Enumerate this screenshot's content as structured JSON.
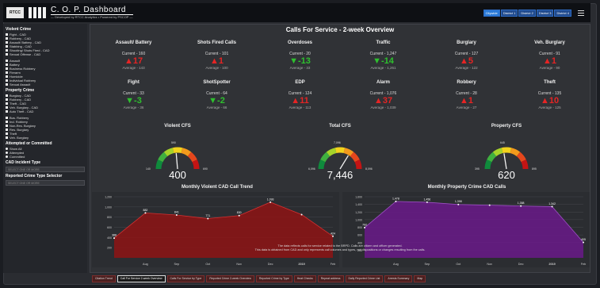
{
  "header": {
    "logo_text": "RTCC",
    "title": "C. O. P. Dashboard",
    "subtitle": "— Developed by RTCC Analytics • Powered by PSCOP —",
    "districts": [
      "Citywide",
      "District 1",
      "District 2",
      "District 3",
      "District 4"
    ],
    "active_district": "Citywide"
  },
  "sidebar": {
    "violent_title": "Violent Crime",
    "violent_items": [
      "Fight - CAD",
      "Robbery - CAD",
      "Assault/ Battery - CAD",
      "Stabbing - CAD",
      "Shooting/ Shots Fired - CAD",
      "Sexual Offense - CAD"
    ],
    "violent_items2": [
      "Assault",
      "Battery",
      "Business Robbery",
      "Firearm",
      "Homicide",
      "Individual Robbery",
      "Sexual Assault"
    ],
    "property_title": "Property Crime",
    "property_items": [
      "Burglary - CAD",
      "Robbery - CAD",
      "Theft - CAD",
      "Veh. Burglary - CAD",
      "Auto Theft - CAD"
    ],
    "property_items2": [
      "Bus. Robbery",
      "Ind. Robbery",
      "Non-Res. Burglary",
      "Res. Burglary",
      "Theft",
      "Veh. Burglary"
    ],
    "attempt_title": "Attempted or Committed",
    "attempt_options": [
      "Show All",
      "Attempted",
      "Committed"
    ],
    "cad_title": "CAD Incident Type",
    "cad_placeholder": "SELECT ONE OR MORE",
    "reported_title": "Reported Crime Type Selector",
    "reported_placeholder": "SELECT ONE OR MORE"
  },
  "main": {
    "title": "Calls For Service - 2-week Overview",
    "kpis": [
      {
        "name": "Assault/ Battery",
        "current": "Current - 160",
        "delta": "▲17",
        "dir": "up",
        "avg": "Average - 143"
      },
      {
        "name": "Shots Fired Calls",
        "current": "Current - 101",
        "delta": "▲1",
        "dir": "up",
        "avg": "Average - 100"
      },
      {
        "name": "Overdoses",
        "current": "Current - 20",
        "delta": "▼-13",
        "dir": "down",
        "avg": "Average - 33"
      },
      {
        "name": "Traffic",
        "current": "Current - 1,247",
        "delta": "▼-14",
        "dir": "down",
        "avg": "Average - 1,261"
      },
      {
        "name": "Burglary",
        "current": "Current - 127",
        "delta": "▲5",
        "dir": "up",
        "avg": "Average - 122"
      },
      {
        "name": "Veh. Burglary",
        "current": "Current - 91",
        "delta": "▲1",
        "dir": "up",
        "avg": "Average - 90"
      },
      {
        "name": "Fight",
        "current": "Current - 33",
        "delta": "▼-3",
        "dir": "down",
        "avg": "Average - 36"
      },
      {
        "name": "ShotSpotter",
        "current": "Current - 64",
        "delta": "▼-2",
        "dir": "down",
        "avg": "Average - 66"
      },
      {
        "name": "EDP",
        "current": "Current - 124",
        "delta": "▲11",
        "dir": "up",
        "avg": "Average - 113"
      },
      {
        "name": "Alarm",
        "current": "Current - 1,076",
        "delta": "▲37",
        "dir": "up",
        "avg": "Average - 1,039"
      },
      {
        "name": "Robbery",
        "current": "Current - 28",
        "delta": "▲1",
        "dir": "up",
        "avg": "Average - 27"
      },
      {
        "name": "Theft",
        "current": "Current - 135",
        "delta": "▲10",
        "dir": "up",
        "avg": "Average - 125"
      }
    ],
    "gauges": [
      {
        "title": "Violent CFS",
        "value": "400",
        "target": "590",
        "min": "140",
        "max": "690"
      },
      {
        "title": "Total CFS",
        "value": "7,446",
        "target": "7,096",
        "min": "6,096",
        "max": "8,096"
      },
      {
        "title": "Property CFS",
        "value": "620",
        "target": "645",
        "min": "395",
        "max": "895"
      }
    ],
    "footnote_1": "The data reflects calls for service related to the BRPD. Calls are citizen and officer generated.",
    "footnote_2": "This data is obtained from CAD and only represents call volumes and types, not dispositions or changes resulting from the calls."
  },
  "colors": {
    "up": "#e52424",
    "down": "#2ec02e",
    "violent_fill": "#8e1414",
    "property_fill": "#6a1a8a"
  },
  "chart_data": [
    {
      "type": "area",
      "title": "Monthly Violent CAD Call Trend",
      "x": [
        "Aug",
        "Sep",
        "Oct",
        "Nov",
        "Dec",
        "2019",
        "Feb"
      ],
      "x_points": [
        "Jul",
        "Aug",
        "Sep",
        "Oct",
        "Nov",
        "Dec",
        "Jan",
        "Feb"
      ],
      "values": [
        388,
        882,
        841,
        771,
        830,
        1093,
        850,
        424
      ],
      "data_labels": [
        "388",
        "882",
        "841",
        "771",
        "830",
        "1,093",
        "",
        "424"
      ],
      "yticks": [
        200,
        400,
        600,
        800,
        1000,
        1200
      ],
      "ylim": [
        0,
        1200
      ]
    },
    {
      "type": "area",
      "title": "Monthly Property Crime CAD Calls",
      "x": [
        "Aug",
        "Sep",
        "Oct",
        "Nov",
        "Dec",
        "2019",
        "Feb"
      ],
      "x_points": [
        "Jul",
        "Aug",
        "Sep",
        "Oct",
        "Nov",
        "Dec",
        "Jan",
        "Feb"
      ],
      "values": [
        792,
        1478,
        1456,
        1398,
        1380,
        1358,
        1342,
        405
      ],
      "data_labels": [
        "792",
        "1,478",
        "1,456",
        "1,398",
        "",
        "1,358",
        "1,342",
        "405"
      ],
      "yticks": [
        200,
        400,
        600,
        800,
        1000,
        1200,
        1400,
        1600
      ],
      "ylim": [
        0,
        1600
      ]
    }
  ],
  "tabs": [
    "Citation Trend",
    "Call For Service 2-week Overview",
    "Calls For Service by Type",
    "Reported Crime 2-week Overview",
    "Reported Crime by Type",
    "Heat Checks",
    "Repeat address",
    "Daily Reported Crime List",
    "Arrests Summary",
    "Map"
  ],
  "active_tab": "Call For Service 2-week Overview"
}
